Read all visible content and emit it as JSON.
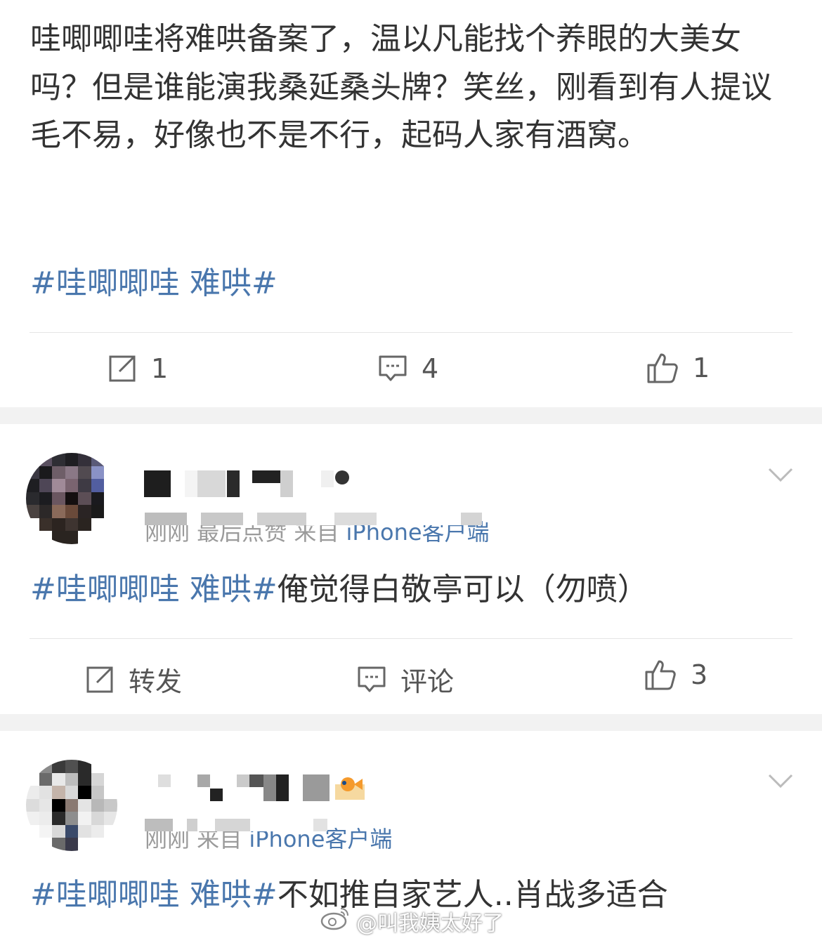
{
  "post": {
    "text": "哇唧唧哇将难哄备案了，温以凡能找个养眼的大美女吗？但是谁能演我桑延桑头牌？笑丝，刚看到有人提议毛不易，好像也不是不行，起码人家有酒窝。",
    "topic": "#哇唧唧哇 难哄#",
    "actions": {
      "repost_count": "1",
      "comment_count": "4",
      "like_count": "1"
    }
  },
  "comments": [
    {
      "meta_prefix": "刚刚 最后点赞 来自 ",
      "meta_source": "iPhone客户端",
      "topic": "#哇唧唧哇 难哄#",
      "text": "俺觉得白敬亭可以（勿喷）",
      "actions": {
        "repost_label": "转发",
        "comment_label": "评论",
        "like_count": "3"
      }
    },
    {
      "meta_prefix": "刚刚 来自 ",
      "meta_source": "iPhone客户端",
      "topic": "#哇唧唧哇 难哄#",
      "text": "不如推自家艺人..肖战多适合"
    }
  ],
  "watermark": "@叫我姨太好了",
  "colors": {
    "link": "#4a77ad",
    "text": "#333333",
    "meta": "#9b9b9b",
    "divider": "#f2f2f2"
  },
  "icons": [
    "repost-icon",
    "comment-icon",
    "like-icon",
    "chevron-down-icon",
    "weibo-logo-icon"
  ]
}
